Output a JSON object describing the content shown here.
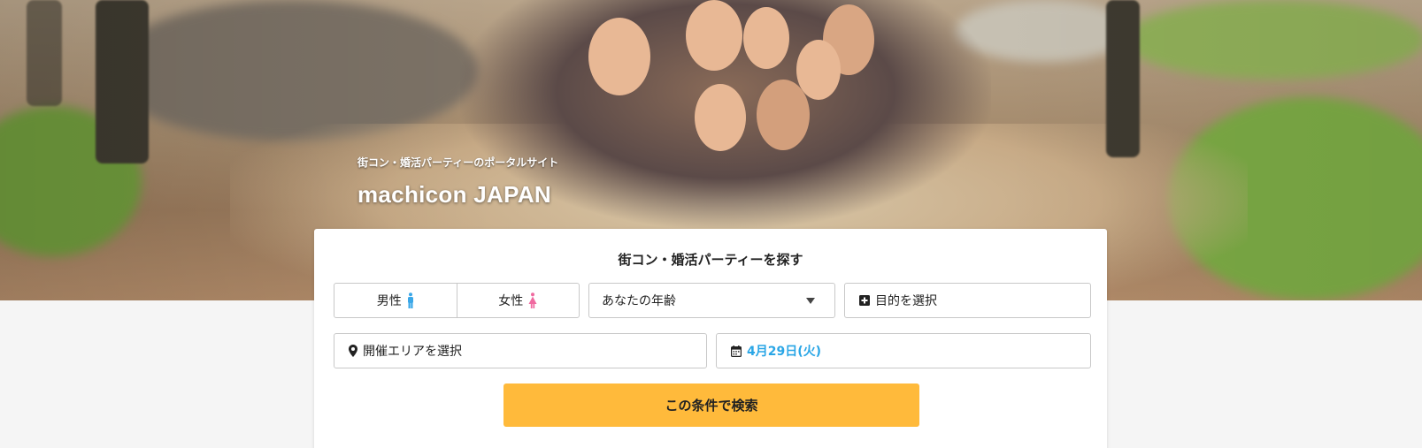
{
  "hero": {
    "subtitle": "街コン・婚活パーティーのポータルサイト",
    "title": "machicon JAPAN"
  },
  "search": {
    "heading": "街コン・婚活パーティーを探す",
    "gender": {
      "male_label": "男性",
      "female_label": "女性",
      "male_color": "#3aa7e8",
      "female_color": "#f06aa0"
    },
    "age_placeholder": "あなたの年齢",
    "purpose_placeholder": "目的を選択",
    "area_placeholder": "開催エリアを選択",
    "date_value": "4月29日(火)",
    "submit_label": "この条件で検索",
    "accent_color": "#ffba3b",
    "date_color": "#2aa6e6"
  },
  "icons": {
    "male": "male-person-icon",
    "female": "female-person-icon",
    "dropdown": "caret-down-icon",
    "purpose": "plus-square-icon",
    "area": "map-pin-icon",
    "date": "calendar-icon"
  }
}
